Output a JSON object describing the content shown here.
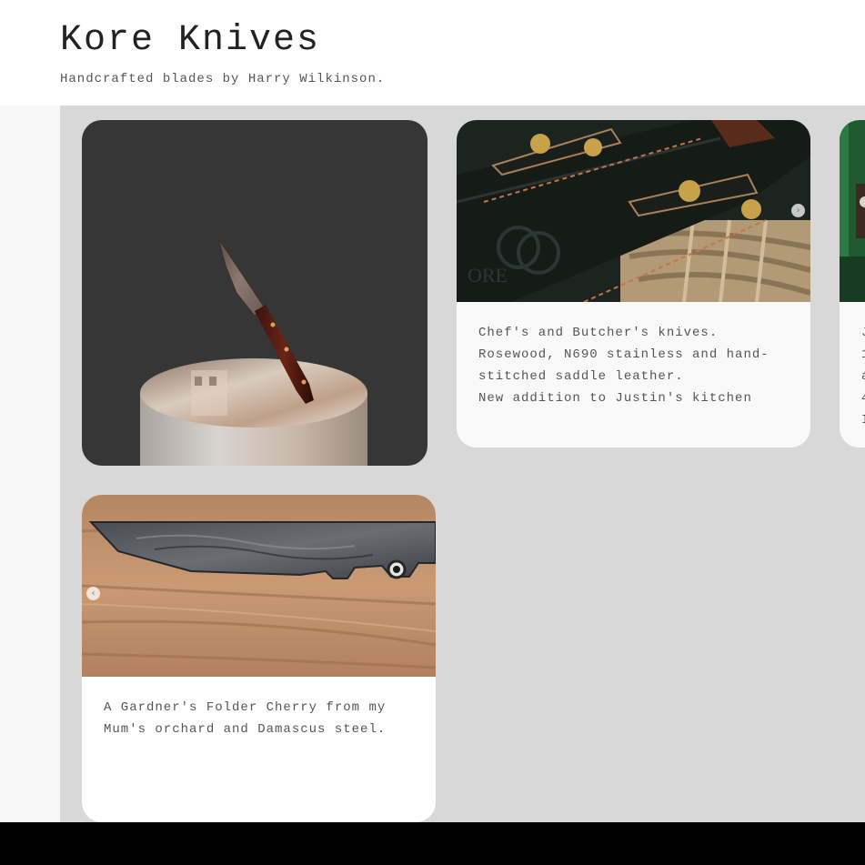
{
  "site": {
    "title": "Kore Knives",
    "tagline": "Handcrafted blades by Harry Wilkinson."
  },
  "cards": [
    {
      "kind": "3d-model",
      "image": "knife-on-cylinder-render"
    },
    {
      "kind": "photo",
      "image": "leather-knife-sheaths",
      "nav_icon": "chevron-right-icon",
      "lines": [
        "Chef's and Butcher's knives.",
        "Rosewood, N690 stainless and hand-",
        "stitched saddle leather.",
        "New addition to Justin's kitchen"
      ]
    },
    {
      "kind": "photo",
      "image": "green-partial-photo",
      "lines": [
        "J",
        "1",
        "a",
        "4",
        "I"
      ]
    },
    {
      "kind": "photo",
      "image": "damascus-blade-on-wood",
      "nav_icon": "chevron-left-icon",
      "lines": [
        "A Gardner's Folder Cherry from my",
        "Mum's orchard and Damascus steel."
      ]
    }
  ],
  "arrows": {
    "next": "›",
    "prev": "‹"
  },
  "colors": {
    "gallery_bg": "#d8d8d8",
    "render_bg": "#363636",
    "bottom_bar": "#000000"
  }
}
